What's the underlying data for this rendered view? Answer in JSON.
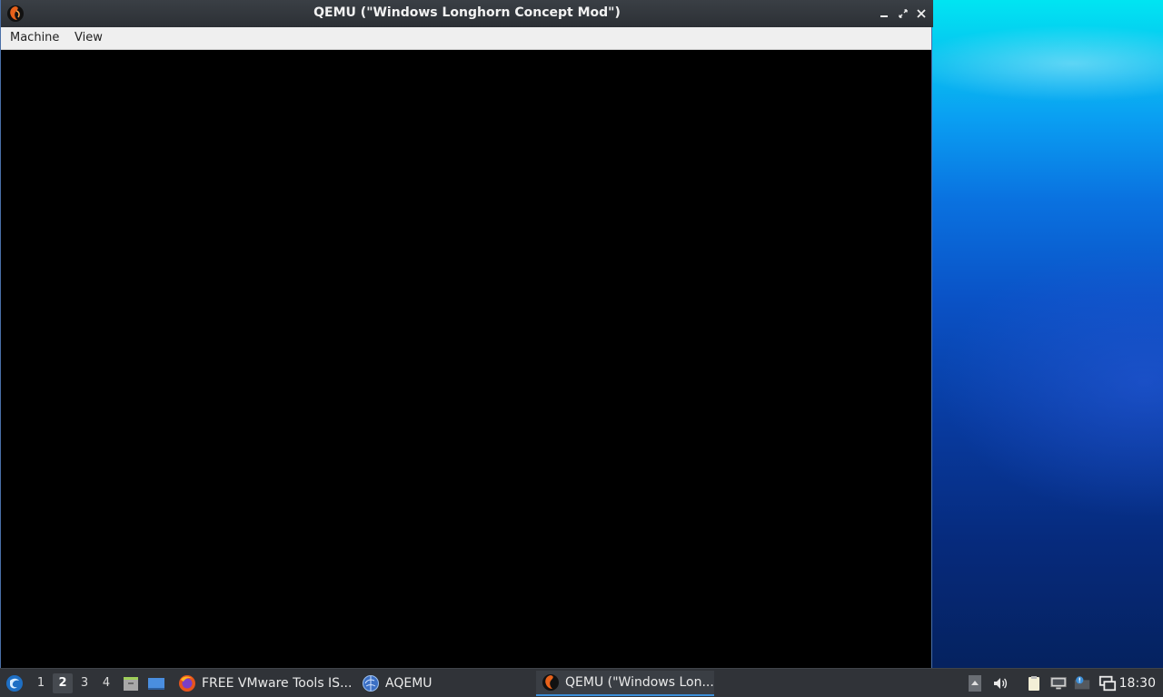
{
  "window": {
    "title": "QEMU (\"Windows Longhorn Concept Mod\")",
    "menu": [
      "Machine",
      "View"
    ]
  },
  "taskbar": {
    "desktops": [
      "1",
      "2",
      "3",
      "4"
    ],
    "active_desktop": "2",
    "tasks": [
      {
        "label": "FREE VMware Tools IS...",
        "icon": "firefox-icon"
      },
      {
        "label": "AQEMU",
        "icon": "aqemu-icon"
      },
      {
        "label": "QEMU (\"Windows Lon...",
        "icon": "qemu-icon",
        "active": true
      }
    ],
    "clock": "18:30"
  },
  "colors": {
    "title_bar": "#2c3035",
    "menu_bar": "#efefef",
    "vm_display": "#000000",
    "taskbar": "#303338",
    "active_task_underline": "#3d8fd8"
  }
}
